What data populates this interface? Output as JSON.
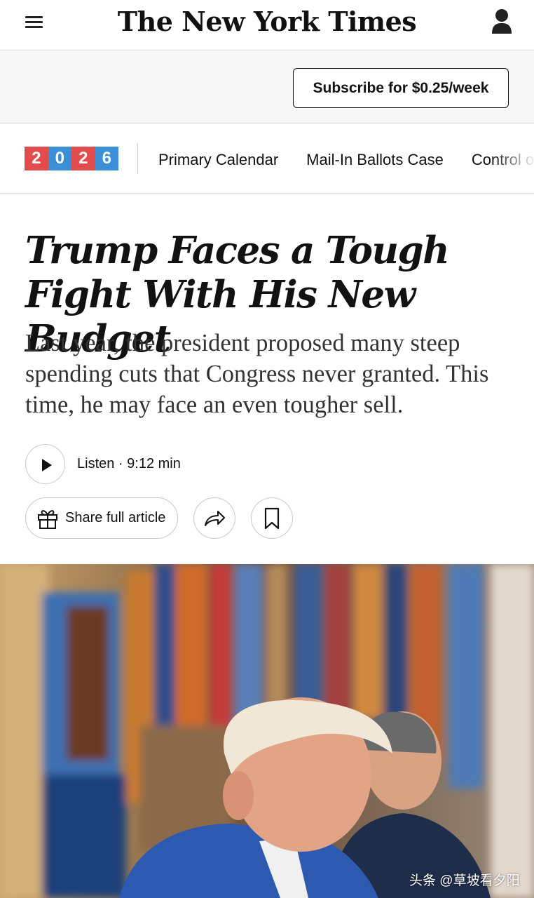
{
  "header": {
    "logo_text": "The New York Times",
    "menu_icon": "hamburger-menu-icon",
    "account_icon": "person-icon"
  },
  "subscribe": {
    "label": "Subscribe for $0.25/week"
  },
  "nav": {
    "year_digits": [
      "2",
      "0",
      "2",
      "6"
    ],
    "year_colors": [
      "#e34c4c",
      "#3b8fd6",
      "#e34c4c",
      "#3b8fd6"
    ],
    "links": [
      "Primary Calendar",
      "Mail-In Ballots Case",
      "Control of"
    ]
  },
  "article": {
    "headline": "Trump Faces a Tough Fight With His New Budget",
    "summary": "Last year, the president proposed many steep spending cuts that Congress never granted. This time, he may face an even tougher sell.",
    "listen_label": "Listen · 9:12 min",
    "share_label": "Share full article",
    "icons": [
      "play-icon",
      "gift-icon",
      "share-arrow-icon",
      "bookmark-icon"
    ]
  },
  "photo": {
    "watermark": "头条 @草坡看夕阳"
  }
}
